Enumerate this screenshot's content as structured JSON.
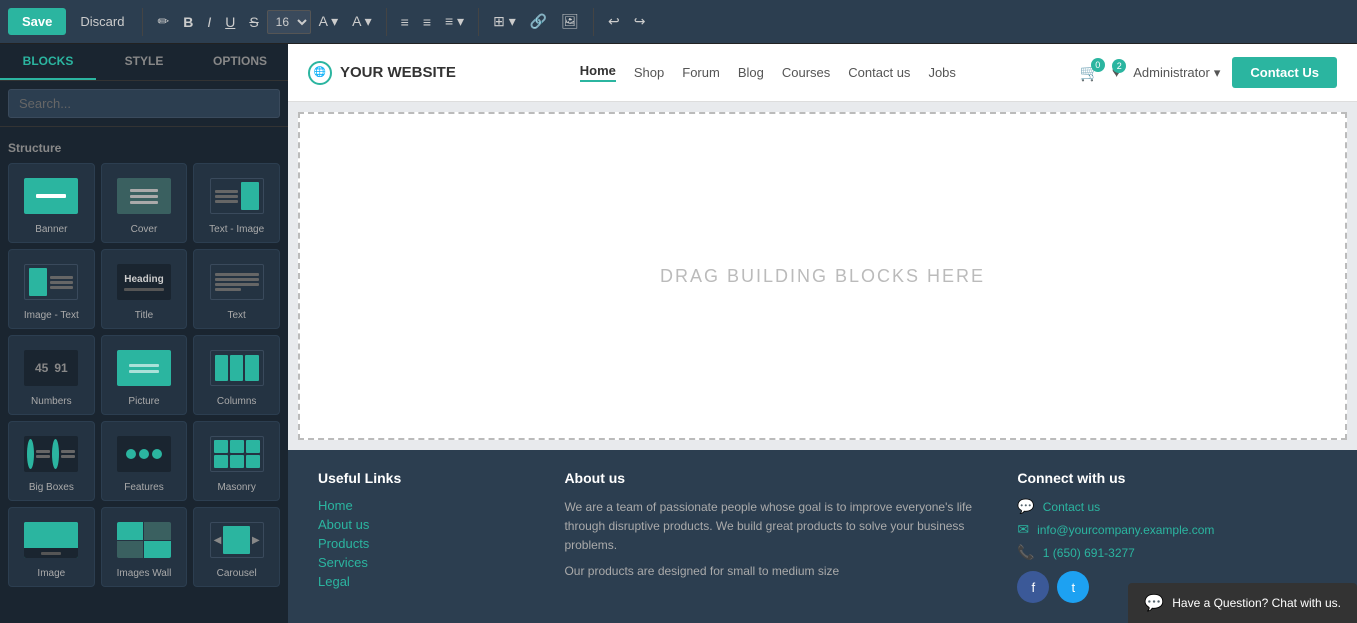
{
  "toolbar": {
    "save_label": "Save",
    "discard_label": "Discard",
    "font_size": "16",
    "tabs": {
      "blocks": "BLOCKS",
      "style": "STYLE",
      "options": "OPTIONS"
    }
  },
  "sidebar": {
    "search_placeholder": "Search...",
    "section_title": "Structure",
    "blocks": [
      {
        "id": "banner",
        "label": "Banner"
      },
      {
        "id": "cover",
        "label": "Cover"
      },
      {
        "id": "text-image",
        "label": "Text - Image"
      },
      {
        "id": "image-text",
        "label": "Image - Text"
      },
      {
        "id": "title",
        "label": "Title"
      },
      {
        "id": "text",
        "label": "Text"
      },
      {
        "id": "numbers",
        "label": "Numbers"
      },
      {
        "id": "picture",
        "label": "Picture"
      },
      {
        "id": "columns",
        "label": "Columns"
      },
      {
        "id": "big-boxes",
        "label": "Big Boxes"
      },
      {
        "id": "features",
        "label": "Features"
      },
      {
        "id": "masonry",
        "label": "Masonry"
      },
      {
        "id": "image",
        "label": "Image"
      },
      {
        "id": "images-wall",
        "label": "Images Wall"
      },
      {
        "id": "carousel",
        "label": "Carousel"
      }
    ]
  },
  "website": {
    "logo_text": "YOUR WEBSITE",
    "nav_items": [
      "Home",
      "Shop",
      "Forum",
      "Blog",
      "Courses",
      "Contact us",
      "Jobs"
    ],
    "nav_active": "Home",
    "cart_count": "0",
    "wishlist_count": "2",
    "admin_label": "Administrator",
    "contact_btn": "Contact Us",
    "dropzone_text": "DRAG BUILDING BLOCKS HERE"
  },
  "footer": {
    "useful_links_title": "Useful Links",
    "useful_links": [
      "Home",
      "About us",
      "Products",
      "Services",
      "Legal"
    ],
    "about_title": "About us",
    "about_text": "We are a team of passionate people whose goal is to improve everyone's life through disruptive products. We build great products to solve your business problems.",
    "about_text2": "Our products are designed for small to medium size",
    "connect_title": "Connect with us",
    "connect_items": [
      {
        "icon": "💬",
        "text": "Contact us"
      },
      {
        "icon": "✉",
        "text": "info@yourcompany.example.com"
      },
      {
        "icon": "📞",
        "text": "1 (650) 691-3277"
      }
    ]
  },
  "chat_widget": {
    "text": "Have a Question? Chat with us."
  }
}
